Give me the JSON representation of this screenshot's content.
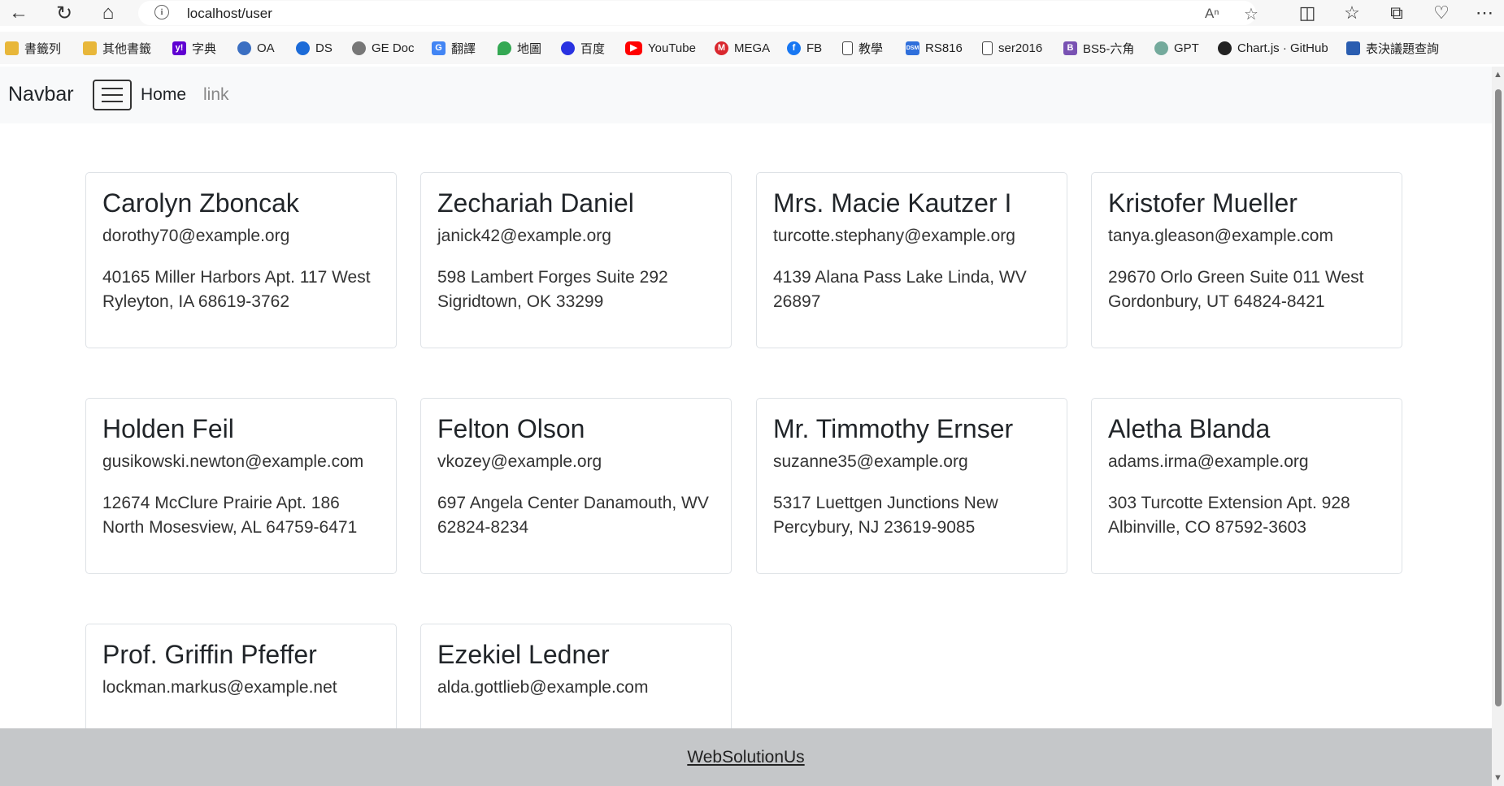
{
  "browser": {
    "url": "localhost/user",
    "bookmarks": [
      {
        "label": "書籤列",
        "icon": "folder-icon",
        "color": "#e8b73a"
      },
      {
        "label": "其他書籤",
        "icon": "folder-icon",
        "color": "#e8b73a"
      },
      {
        "label": "字典",
        "icon": "yahoo-icon",
        "color": "#6001d2"
      },
      {
        "label": "OA",
        "icon": "oa-icon",
        "color": "#3b6fc2"
      },
      {
        "label": "DS",
        "icon": "ge-icon",
        "color": "#1c6bd8"
      },
      {
        "label": "GE Doc",
        "icon": "ge-doc-icon",
        "color": "#777777"
      },
      {
        "label": "翻譯",
        "icon": "translate-icon",
        "color": "#4285f4"
      },
      {
        "label": "地圖",
        "icon": "maps-icon",
        "color": "#34a853"
      },
      {
        "label": "百度",
        "icon": "baidu-icon",
        "color": "#2932e1"
      },
      {
        "label": "YouTube",
        "icon": "youtube-icon",
        "color": "#ff0000"
      },
      {
        "label": "MEGA",
        "icon": "mega-icon",
        "color": "#d9272e"
      },
      {
        "label": "FB",
        "icon": "facebook-icon",
        "color": "#1877f2"
      },
      {
        "label": "教學",
        "icon": "page-icon",
        "color": "#ffffff"
      },
      {
        "label": "RS816",
        "icon": "dsm-icon",
        "color": "#2f6fdb"
      },
      {
        "label": "ser2016",
        "icon": "page-icon",
        "color": "#ffffff"
      },
      {
        "label": "BS5-六角",
        "icon": "bootstrap-icon",
        "color": "#7952b3"
      },
      {
        "label": "GPT",
        "icon": "openai-icon",
        "color": "#74aa9c"
      },
      {
        "label": "Chart.js · GitHub",
        "icon": "github-icon",
        "color": "#222222"
      },
      {
        "label": "表決議題查詢",
        "icon": "vote-icon",
        "color": "#2a5db0"
      }
    ]
  },
  "navbar": {
    "brand": "Navbar",
    "home": "Home",
    "link": "link"
  },
  "users": [
    {
      "name": "Carolyn Zboncak",
      "email": "dorothy70@example.org",
      "address": "40165 Miller Harbors Apt. 117 West Ryleyton, IA 68619-3762"
    },
    {
      "name": "Zechariah Daniel",
      "email": "janick42@example.org",
      "address": "598 Lambert Forges Suite 292 Sigridtown, OK 33299"
    },
    {
      "name": "Mrs. Macie Kautzer I",
      "email": "turcotte.stephany@example.org",
      "address": "4139 Alana Pass Lake Linda, WV 26897"
    },
    {
      "name": "Kristofer Mueller",
      "email": "tanya.gleason@example.com",
      "address": "29670 Orlo Green Suite 011 West Gordonbury, UT 64824-8421"
    },
    {
      "name": "Holden Feil",
      "email": "gusikowski.newton@example.com",
      "address": "12674 McClure Prairie Apt. 186 North Mosesview, AL 64759-6471"
    },
    {
      "name": "Felton Olson",
      "email": "vkozey@example.org",
      "address": "697 Angela Center Danamouth, WV 62824-8234"
    },
    {
      "name": "Mr. Timmothy Ernser",
      "email": "suzanne35@example.org",
      "address": "5317 Luettgen Junctions New Percybury, NJ 23619-9085"
    },
    {
      "name": "Aletha Blanda",
      "email": "adams.irma@example.org",
      "address": "303 Turcotte Extension Apt. 928 Albinville, CO 87592-3603"
    },
    {
      "name": "Prof. Griffin Pfeffer",
      "email": "lockman.markus@example.net",
      "address": ""
    },
    {
      "name": "Ezekiel Ledner",
      "email": "alda.gottlieb@example.com",
      "address": ""
    }
  ],
  "footer": {
    "link": "WebSolutionUs"
  }
}
